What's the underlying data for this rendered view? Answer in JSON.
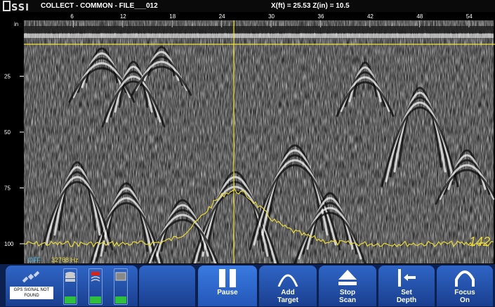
{
  "title_bar": {
    "logo_text": "SSI",
    "title": "COLLECT - COMMON - FILE___012",
    "cursor_readout": "X(ft) = 25.53  Z(in) = 10.5"
  },
  "scan": {
    "depth_unit": "in",
    "depth_ticks": [
      "25",
      "50",
      "75",
      "100"
    ],
    "distance_ticks": [
      "6",
      "12",
      "18",
      "24",
      "30",
      "36",
      "42",
      "48",
      "54"
    ],
    "filter_state": "OFF",
    "frequency": "32768 Hz",
    "gain_value": "142",
    "colors": {
      "cursor": "#f2e33a",
      "filter_off": "#3fb6e8",
      "overlay": "#e8d83a"
    }
  },
  "status": {
    "gps_text": "GPS SIGNAL NOT FOUND",
    "icons": [
      "gps-satellite-icon",
      "storage-icon",
      "antenna-battery-icon",
      "tablet-battery-icon"
    ]
  },
  "toolbar": {
    "pause_label": "Pause",
    "add_target_label": "Add Target",
    "stop_scan_label": "Stop Scan",
    "set_depth_label": "Set Depth",
    "focus_label": "Focus On"
  }
}
